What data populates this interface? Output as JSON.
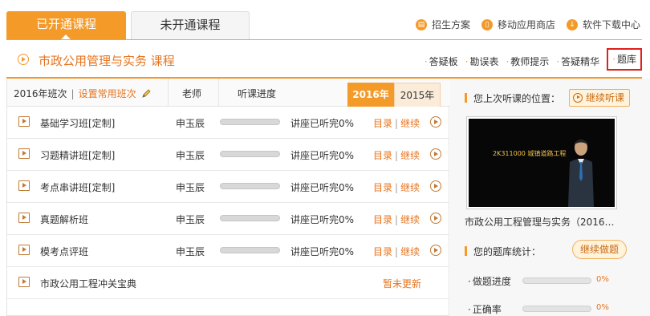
{
  "top_tabs": {
    "active": "已开通课程",
    "inactive": "未开通课程"
  },
  "top_links": [
    {
      "icon": "clipboard-icon",
      "label": "招生方案"
    },
    {
      "icon": "mobile-icon",
      "label": "移动应用商店"
    },
    {
      "icon": "download-icon",
      "label": "软件下载中心"
    }
  ],
  "course": {
    "title": "市政公用管理与实务  课程",
    "links": [
      "答疑板",
      "勘误表",
      "教师提示",
      "答疑精华",
      "题库"
    ],
    "highlighted_link": "题库"
  },
  "left_header": {
    "class_year": "2016年班次",
    "set_common": "设置常用班次",
    "teacher_col": "老师",
    "progress_col": "听课进度",
    "year_tabs": [
      "2016年",
      "2015年"
    ],
    "active_year": "2016年"
  },
  "rows": [
    {
      "name": "基础学习班[定制]",
      "teacher": "申玉辰",
      "progress": 0,
      "progress_text": "讲座已听完0%",
      "catalog": "目录",
      "continue": "继续"
    },
    {
      "name": "习题精讲班[定制]",
      "teacher": "申玉辰",
      "progress": 0,
      "progress_text": "讲座已听完0%",
      "catalog": "目录",
      "continue": "继续"
    },
    {
      "name": "考点串讲班[定制]",
      "teacher": "申玉辰",
      "progress": 0,
      "progress_text": "讲座已听完0%",
      "catalog": "目录",
      "continue": "继续"
    },
    {
      "name": "真题解析班",
      "teacher": "申玉辰",
      "progress": 0,
      "progress_text": "讲座已听完0%",
      "catalog": "目录",
      "continue": "继续"
    },
    {
      "name": "模考点评班",
      "teacher": "申玉辰",
      "progress": 0,
      "progress_text": "讲座已听完0%",
      "catalog": "目录",
      "continue": "继续"
    }
  ],
  "special_row": {
    "name": "市政公用工程冲关宝典",
    "status": "暂未更新"
  },
  "right_panel": {
    "last_position_label": "您上次听课的位置：",
    "continue_button": "继续听课",
    "video_caption": "2K311000   城镇道路工程",
    "course_title": "市政公用工程管理与实务（2016…",
    "stats_label": "您的题库统计：",
    "continue_tiku": "继续做题",
    "stats": [
      {
        "label": "做题进度",
        "value": 0,
        "text": "0%"
      },
      {
        "label": "正确率",
        "value": 0,
        "text": "0%"
      }
    ]
  }
}
